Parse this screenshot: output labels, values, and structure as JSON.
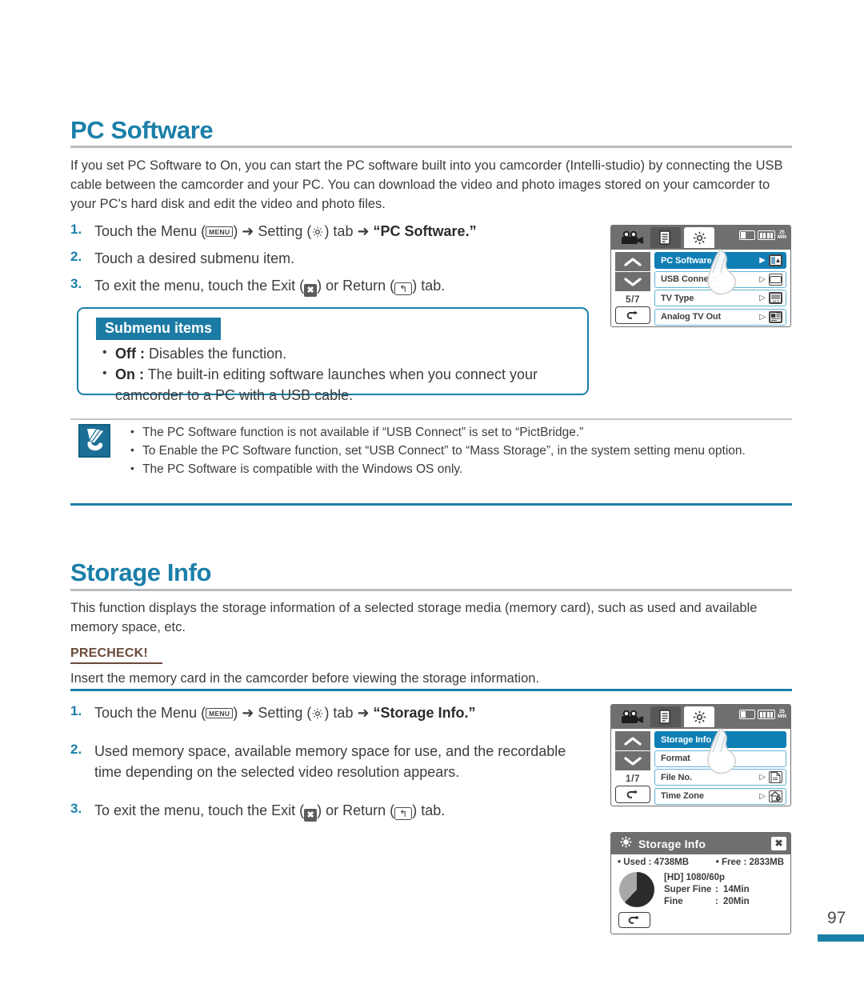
{
  "page": {
    "number": "97"
  },
  "sections": [
    {
      "id": "pc-software",
      "title": "PC Software",
      "intro": "If you set PC Software to On, you can start the PC software built into you camcorder (Intelli-studio) by connecting the USB cable between the camcorder and your PC. You can download the video and photo images stored on your camcorder to your PC's hard disk and edit the video and photo files.",
      "steps": [
        {
          "num": "1.",
          "pre": "Touch the Menu (",
          "menu": "MENU",
          "mid": ") ➜ Setting (",
          "gear": "gear-icon",
          "mid2": ") tab ➜ ",
          "bold": "“PC Software.”",
          "post": ""
        },
        {
          "num": "2.",
          "text": "Touch a desired submenu item."
        },
        {
          "num": "3.",
          "pre": "To exit the menu, touch the Exit (",
          "exit": "✖",
          "mid": ") or Return (",
          "ret": "↰",
          "post": ") tab."
        }
      ],
      "submenu": {
        "badge": "Submenu items",
        "items": [
          {
            "term": "Off :",
            "desc": "Disables the function."
          },
          {
            "term": "On :",
            "desc": "The built-in editing software launches when you connect your camcorder to a PC with a USB cable."
          }
        ]
      },
      "notes": [
        "The PC Software function is not available if “USB Connect” is set to “PictBridge.”",
        "To Enable the PC Software function, set “USB Connect” to “Mass Storage”, in the system setting menu option.",
        "The PC Software is compatible with the Windows OS only."
      ]
    },
    {
      "id": "storage-info",
      "title": "Storage Info",
      "intro": "This function displays the storage information of a selected storage media (memory card), such as used and available memory space, etc.",
      "precheck_label": "PRECHECK!",
      "precheck_text": "Insert the memory card in the camcorder before viewing the storage information.",
      "steps": [
        {
          "num": "1.",
          "pre": "Touch the Menu (",
          "menu": "MENU",
          "mid": ") ➜ Setting (",
          "gear": "gear-icon",
          "mid2": ") tab ➜ ",
          "bold": "“Storage Info.”",
          "post": ""
        },
        {
          "num": "2.",
          "text": "Used memory space, available memory space for use, and the recordable time depending on the selected video resolution appears."
        },
        {
          "num": "3.",
          "pre": "To exit the menu, touch the Exit (",
          "exit": "✖",
          "mid": ") or Return (",
          "ret": "↰",
          "post": ") tab."
        }
      ]
    }
  ],
  "lcd_screens": [
    {
      "id": "lcd-pc-software",
      "tabs": [
        "camcorder-icon",
        "list-icon",
        "gear-icon"
      ],
      "status": {
        "battery": "battery-icon",
        "battery_level": "battery-level-icon",
        "min_label": "25 MIN"
      },
      "page_counter": "5/7",
      "up": "chevron-up-icon",
      "down": "chevron-down-icon",
      "return": "return-icon",
      "rows": [
        {
          "label": "PC Software",
          "selected": true,
          "arrow": "▶",
          "icon": "pc-software-icon"
        },
        {
          "label": "USB Connect",
          "selected": false,
          "arrow": "▷",
          "icon": "usb-connect-icon"
        },
        {
          "label": "TV Type",
          "selected": false,
          "arrow": "▷",
          "icon": "tv-type-icon"
        },
        {
          "label": "Analog TV Out",
          "selected": false,
          "arrow": "▷",
          "icon": "analog-tv-out-icon"
        }
      ]
    },
    {
      "id": "lcd-storage-info",
      "tabs": [
        "camcorder-icon",
        "list-icon",
        "gear-icon"
      ],
      "status": {
        "battery": "battery-icon",
        "battery_level": "battery-level-icon",
        "min_label": "25 MIN"
      },
      "page_counter": "1/7",
      "up": "chevron-up-icon",
      "down": "chevron-down-icon",
      "return": "return-icon",
      "rows": [
        {
          "label": "Storage Info",
          "selected": true,
          "arrow": "",
          "icon": ""
        },
        {
          "label": "Format",
          "selected": false,
          "arrow": "",
          "icon": ""
        },
        {
          "label": "File No.",
          "selected": false,
          "arrow": "▷",
          "icon": "file-no-icon"
        },
        {
          "label": "Time Zone",
          "selected": false,
          "arrow": "▷",
          "icon": "time-zone-icon"
        }
      ]
    }
  ],
  "storage_dialog": {
    "gear": "gear-icon",
    "title": "Storage Info",
    "close": "✖",
    "used_label": "• Used : 4738MB",
    "free_label": "• Free : 2833MB",
    "resolution": "[HD] 1080/60p",
    "rows": [
      {
        "key": "Super Fine",
        "colon": ":",
        "value": "14Min"
      },
      {
        "key": "Fine",
        "colon": ":",
        "value": "20Min"
      }
    ],
    "return": "return-icon",
    "pie": {
      "used_pct": 62,
      "free_pct": 38,
      "used_color": "#2b2b2b",
      "free_color": "#a8a8a8"
    }
  },
  "colors": {
    "heading_blue": "#1b7fa8",
    "badge_blue": "#1c7ba4",
    "lcd_select_blue": "#0f7fb5",
    "lcd_row_border": "#5fb4d8"
  }
}
